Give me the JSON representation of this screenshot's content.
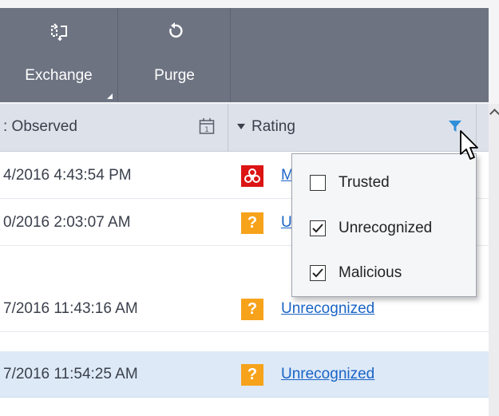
{
  "toolbar": {
    "exchange_label": "Exchange",
    "purge_label": "Purge"
  },
  "columns": {
    "observed": ": Observed",
    "rating": "Rating"
  },
  "rows": [
    {
      "date": "4/2016 4:43:54 PM",
      "rating": "M",
      "badge": "malicious"
    },
    {
      "date": "0/2016 2:03:07 AM",
      "rating": "U",
      "badge": "unknown"
    },
    {
      "date": "7/2016 11:43:16 AM",
      "rating": "Unrecognized",
      "badge": "unknown"
    },
    {
      "date": "7/2016 11:54:25 AM",
      "rating": "Unrecognized",
      "badge": "unknown",
      "selected": true
    }
  ],
  "unknown_glyph": "?",
  "filter": {
    "options": [
      {
        "label": "Trusted",
        "checked": false
      },
      {
        "label": "Unrecognized",
        "checked": true
      },
      {
        "label": "Malicious",
        "checked": true
      }
    ]
  },
  "colors": {
    "toolbar": "#6d7381",
    "header": "#dde1ea",
    "selected_row": "#dde9f7",
    "link": "#1a64c6",
    "unknown_badge": "#f7a21b",
    "malicious_badge": "#dc1414",
    "filter_icon": "#2f8fd8"
  }
}
